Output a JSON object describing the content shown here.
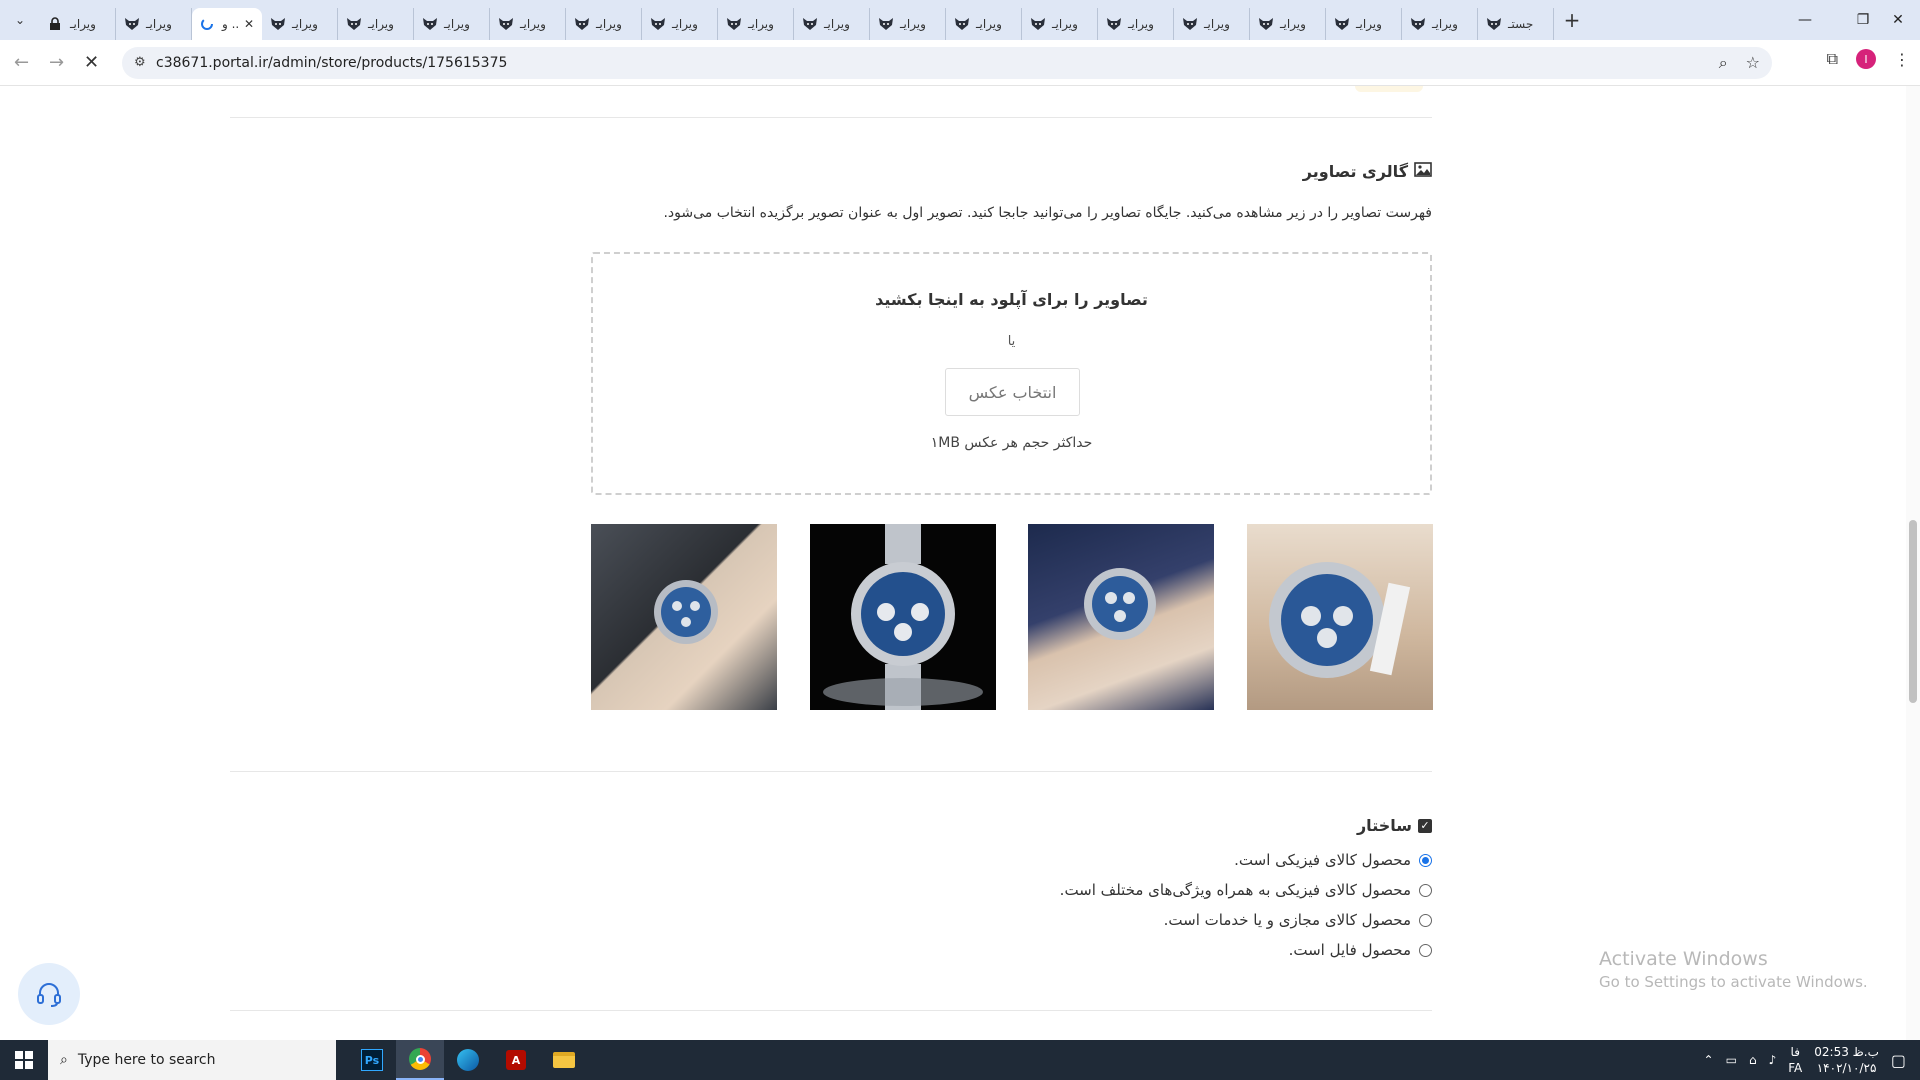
{
  "browser": {
    "tabs": [
      {
        "label": "ویرایـ",
        "icon": "lock-icon"
      },
      {
        "label": "ویرایـ",
        "icon": "fox-icon"
      },
      {
        "label": "و ..",
        "icon": "spinner-icon",
        "active": true
      },
      {
        "label": "ویرایـ",
        "icon": "fox-icon"
      },
      {
        "label": "ویرایـ",
        "icon": "fox-icon"
      },
      {
        "label": "ویرایـ",
        "icon": "fox-icon"
      },
      {
        "label": "ویرایـ",
        "icon": "fox-icon"
      },
      {
        "label": "ویرایـ",
        "icon": "fox-icon"
      },
      {
        "label": "ویرایـ",
        "icon": "fox-icon"
      },
      {
        "label": "ویرایـ",
        "icon": "fox-icon"
      },
      {
        "label": "ویرایـ",
        "icon": "fox-icon"
      },
      {
        "label": "ویرایـ",
        "icon": "fox-icon"
      },
      {
        "label": "ویرایـ",
        "icon": "fox-icon"
      },
      {
        "label": "ویرایـ",
        "icon": "fox-icon"
      },
      {
        "label": "ویرایـ",
        "icon": "fox-icon"
      },
      {
        "label": "ویرایـ",
        "icon": "fox-icon"
      },
      {
        "label": "ویرایـ",
        "icon": "fox-icon"
      },
      {
        "label": "ویرایـ",
        "icon": "fox-icon"
      },
      {
        "label": "ویرایـ",
        "icon": "fox-icon"
      },
      {
        "label": "جستـ",
        "icon": "fox-icon"
      }
    ],
    "new_tab": "+",
    "url": "c38671.portal.ir/admin/store/products/175615375",
    "avatar_letter": "I"
  },
  "gallery": {
    "title": "گالری تصاویر",
    "description": "فهرست تصاویر را در زیر مشاهده می‌کنید. جایگاه تصاویر را می‌توانید جابجا کنید. تصویر اول به عنوان تصویر برگزیده انتخاب می‌شود.",
    "dropzone_title": "تصاویر را برای آپلود به اینجا بکشید",
    "or_label": "یا",
    "choose_button": "انتخاب عکس",
    "size_note": "حداکثر حجم هر عکس ۱MB",
    "images": [
      {
        "alt": "wrist-watch-on-keyboard"
      },
      {
        "alt": "watch-splash-black"
      },
      {
        "alt": "watch-on-wrist-suit"
      },
      {
        "alt": "watch-in-box"
      }
    ]
  },
  "structure": {
    "title": "ساختار",
    "options": [
      {
        "label": "محصول کالای فیزیکی است.",
        "checked": true
      },
      {
        "label": "محصول کالای فیزیکی به همراه ویژگی‌های مختلف است.",
        "checked": false
      },
      {
        "label": "محصول کالای مجازی و یا خدمات است.",
        "checked": false
      },
      {
        "label": "محصول فایل است.",
        "checked": false
      }
    ]
  },
  "watermark": {
    "line1": "Activate Windows",
    "line2": "Go to Settings to activate Windows."
  },
  "taskbar": {
    "search_placeholder": "Type here to search",
    "lang": "FA",
    "lang2": "فا",
    "time": "02:53 ب.ظ",
    "date": "۱۴۰۲/۱۰/۲۵"
  },
  "colors": {
    "accent": "#1a73e8",
    "tabbar": "#dfe7f5"
  }
}
